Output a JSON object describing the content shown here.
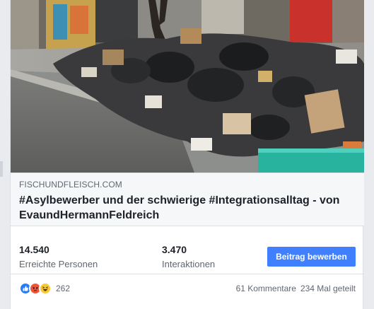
{
  "link_preview": {
    "domain": "FISCHUNDFLEISCH.COM",
    "title_line1": "#Asylbewerber und der schwierige #Integrationsalltag - von",
    "title_line2": "EvaundHermannFeldreich"
  },
  "insights": {
    "reach_value": "14.540",
    "reach_label": "Erreichte Personen",
    "engagement_value": "3.470",
    "engagement_label": "Interaktionen",
    "boost_label": "Beitrag bewerben"
  },
  "reactions": {
    "count": "262",
    "icons": [
      "like-icon",
      "angry-icon",
      "haha-icon"
    ],
    "comments": "61 Kommentare",
    "shares": "234 Mal geteilt"
  },
  "colors": {
    "accent": "#4080ff",
    "like": "#2a7bf6",
    "angry": "#f0553b",
    "haha": "#f7c936"
  }
}
